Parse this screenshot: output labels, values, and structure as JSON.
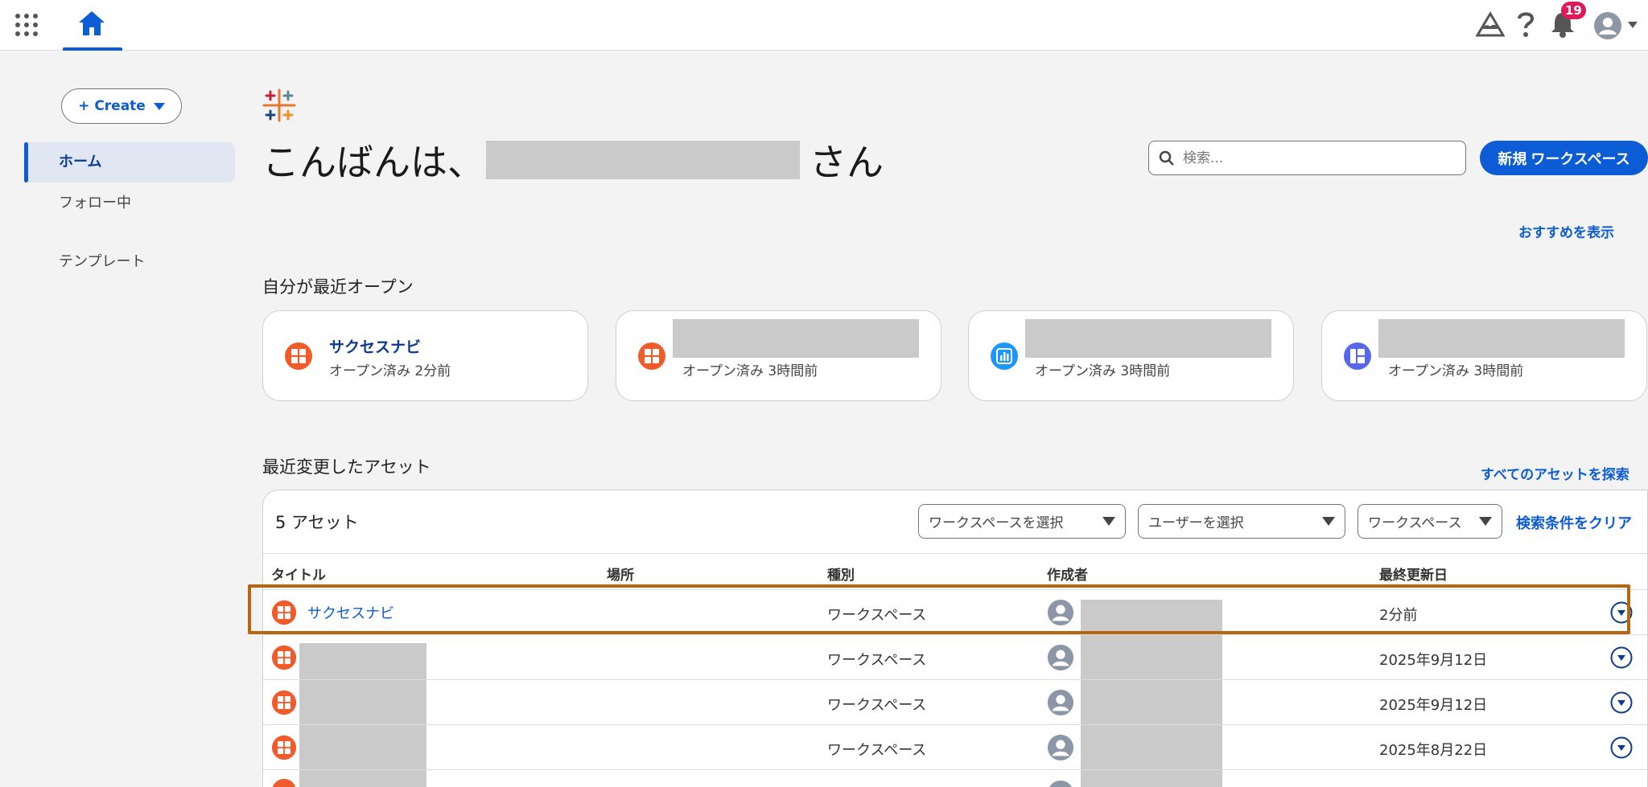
{
  "topbar": {
    "notifications_count": "19",
    "icons": [
      "apps-grid-icon",
      "home-icon",
      "cloud-icon",
      "help-icon",
      "bell-icon",
      "user-avatar-icon"
    ]
  },
  "sidebar": {
    "create_label": "+ Create",
    "items": [
      {
        "label": "ホーム",
        "active": true
      },
      {
        "label": "フォロー中",
        "active": false
      },
      {
        "label": "テンプレート",
        "active": false
      }
    ]
  },
  "main": {
    "greeting_prefix": "こんばんは、",
    "greeting_suffix": "さん",
    "search": {
      "placeholder": "検索..."
    },
    "new_workspace_label": "新規 ワークスペース",
    "show_recommendations_label": "おすすめを表示",
    "recent_title": "自分が最近オープン",
    "recent_cards": [
      {
        "title": "サクセスナビ",
        "subtitle": "オープン済み 2分前",
        "icon": "workspace-icon",
        "color": "#f15a29"
      },
      {
        "title": "",
        "subtitle": "オープン済み 3時間前",
        "icon": "workspace-icon",
        "color": "#f15a29"
      },
      {
        "title": "",
        "subtitle": "オープン済み 3時間前",
        "icon": "dashboard-icon",
        "color": "#1b96ff"
      },
      {
        "title": "",
        "subtitle": "オープン済み 3時間前",
        "icon": "layout-icon",
        "color": "#5867e8"
      }
    ],
    "assets_title": "最近変更したアセット",
    "explore_all_label": "すべてのアセットを探索",
    "asset_count": "5 アセット",
    "filters": {
      "workspace_select": "ワークスペースを選択",
      "user_select": "ユーザーを選択",
      "type_select": "ワークスペース",
      "clear_label": "検索条件をクリア"
    },
    "columns": [
      "タイトル",
      "場所",
      "種別",
      "作成者",
      "最終更新日"
    ],
    "rows": [
      {
        "title": "サクセスナビ",
        "type": "ワークスペース",
        "date": "2分前"
      },
      {
        "title": "",
        "type": "ワークスペース",
        "date": "2025年9月12日"
      },
      {
        "title": "",
        "type": "ワークスペース",
        "date": "2025年9月12日"
      },
      {
        "title": "",
        "type": "ワークスペース",
        "date": "2025年8月22日"
      }
    ]
  },
  "colors": {
    "accent": "#0b5cd5",
    "highlight": "#b8650d",
    "badge": "#e0195a",
    "workspace_icon": "#f15a29"
  }
}
